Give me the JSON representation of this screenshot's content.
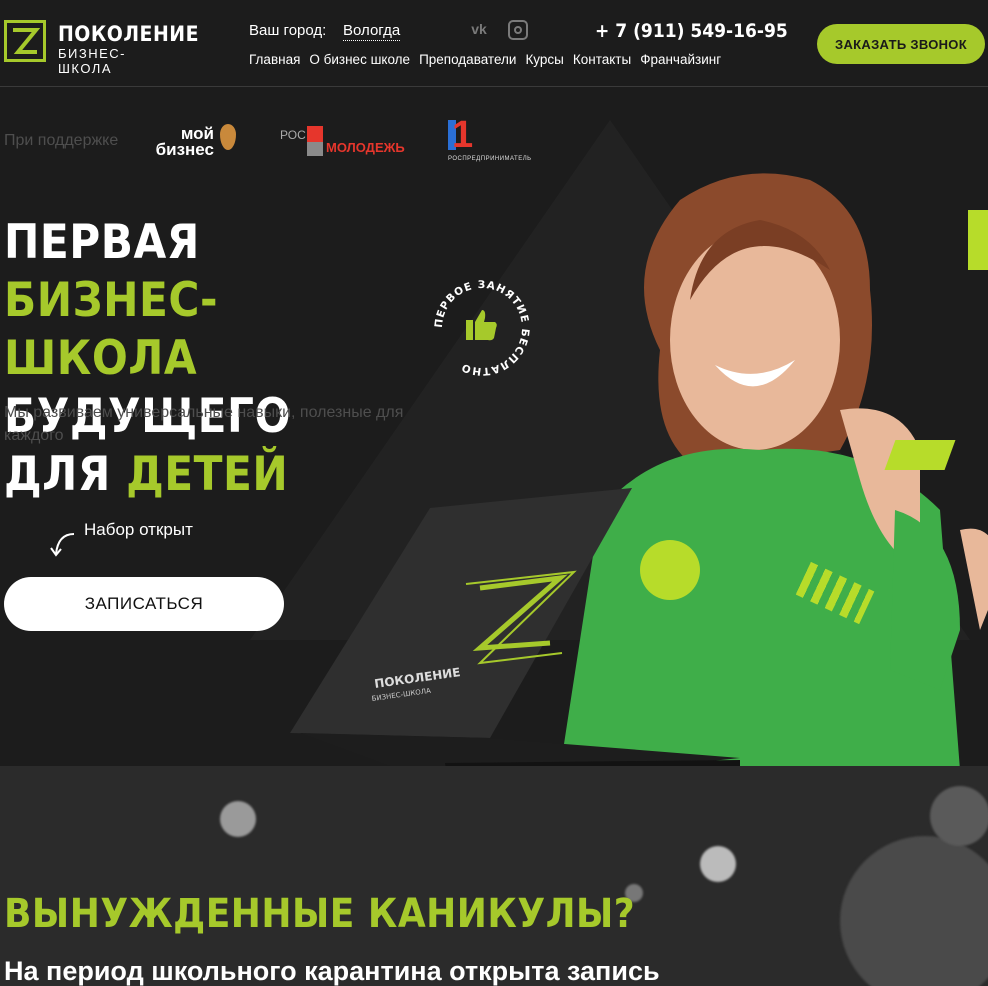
{
  "brand": {
    "title": "ПОКОЛЕНИЕ",
    "subtitle": "БИЗНЕС-ШКОЛА",
    "accent": "#a6c92b"
  },
  "header": {
    "city_label": "Ваш город:",
    "city_value": "Вологда",
    "social": [
      "vk-icon",
      "instagram-icon"
    ],
    "phone": "+ 7 (911) 549-16-95",
    "call_button": "ЗАКАЗАТЬ ЗВОНОК",
    "nav": [
      "Главная",
      "О бизнес школе",
      "Преподаватели",
      "Курсы",
      "Контакты",
      "Франчайзинг"
    ]
  },
  "support": {
    "label": "При поддержке",
    "partners": {
      "moi_biznes": [
        "мой",
        "бизнес"
      ],
      "ros_molodezh": {
        "prefix": "РОС",
        "word": "МОЛОДЕЖЬ"
      },
      "rospredprinimatel": {
        "mark": "1",
        "word": "РОСПРЕДПРИНИМАТЕЛЬ"
      }
    }
  },
  "hero": {
    "line1_a": "ПЕРВАЯ ",
    "line1_b": "БИЗНЕС-",
    "line2_a": "ШКОЛА",
    "line2_b": " БУДУЩЕГО",
    "line3_a": "ДЛЯ ",
    "line3_b": "ДЕТЕЙ",
    "subtext": "Мы развиваем универсальные навыки, полезные для каждого",
    "recruit": "Набор открыт",
    "signup_button": "ЗАПИСАТЬСЯ",
    "badge_text": "ПЕРВОЕ ЗАНЯТИЕ БЕСПЛАТНО"
  },
  "laptop": {
    "brand": "ПОКОЛЕНИЕ",
    "sub": "БИЗНЕС-ШКОЛА"
  },
  "section2": {
    "title": "ВЫНУЖДЕННЫЕ КАНИКУЛЫ?",
    "text": "На период школьного карантина открыта запись"
  }
}
